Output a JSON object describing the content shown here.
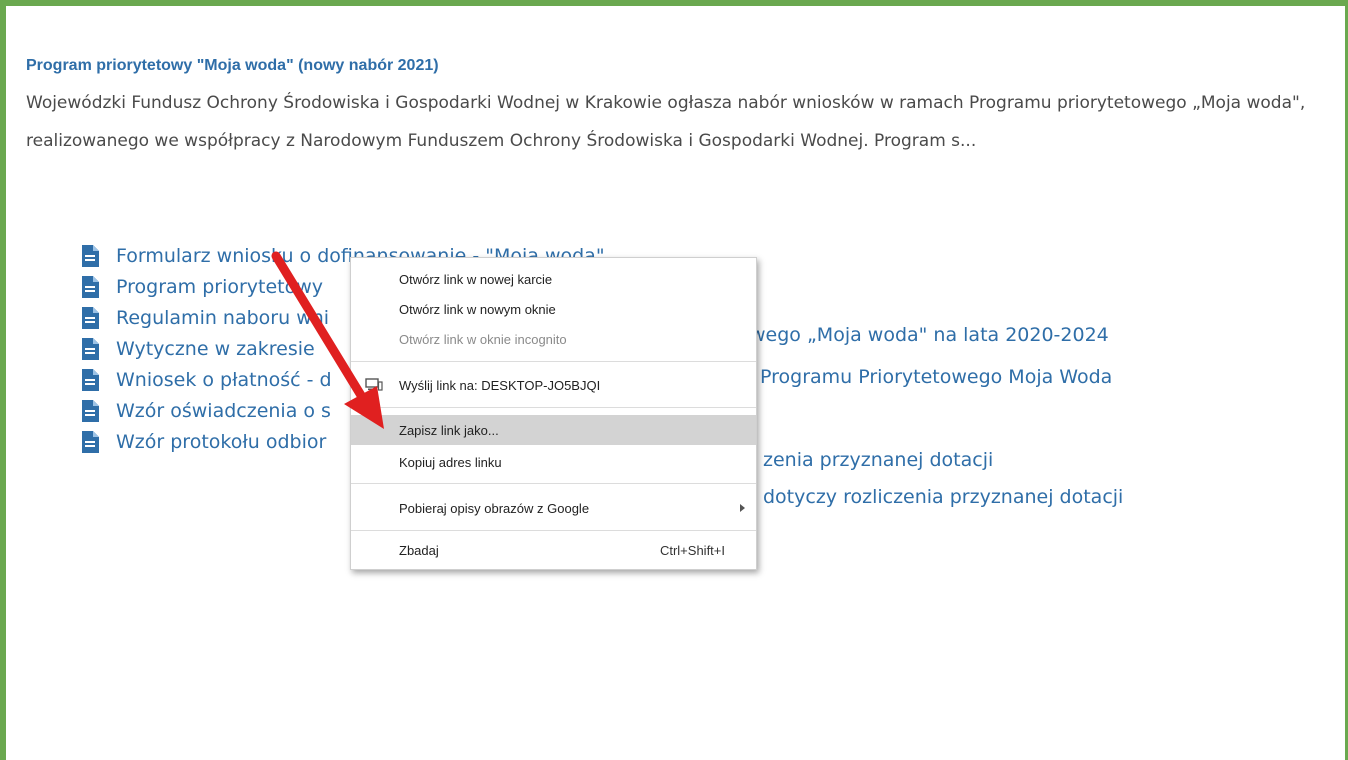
{
  "article": {
    "title": "Program priorytetowy \"Moja woda\" (nowy nabór 2021)",
    "description": "Wojewódzki Fundusz Ochrony Środowiska i Gospodarki Wodnej w Krakowie ogłasza nabór wniosków w ramach Programu priorytetowego „Moja woda\", realizowanego we współpracy z Narodowym Funduszem Ochrony Środowiska i Gospodarki Wodnej. Program s..."
  },
  "attachments": [
    {
      "left": "Formularz wniosku o dofinansowanie - \"Moja woda\"",
      "right": ""
    },
    {
      "left": "Program priorytetowy",
      "right": ""
    },
    {
      "left": "Regulamin naboru wni",
      "right": "wego „Moja woda\" na lata 2020-2024"
    },
    {
      "left": "Wytyczne w zakresie",
      "right": "Programu Priorytetowego Moja Woda"
    },
    {
      "left": "Wniosek o płatność - d",
      "right": ""
    },
    {
      "left": "Wzór oświadczenia o s",
      "right": "zenia przyznanej dotacji"
    },
    {
      "left": "Wzór protokołu odbior",
      "right": "dotyczy rozliczenia przyznanej dotacji"
    }
  ],
  "context_menu": {
    "items": [
      {
        "label": "Otwórz link w nowej karcie"
      },
      {
        "label": "Otwórz link w nowym oknie"
      },
      {
        "label": "Otwórz link w oknie incognito"
      },
      {
        "label": "Wyślij link na: DESKTOP-JO5BJQI"
      },
      {
        "label": "Zapisz link jako..."
      },
      {
        "label": "Kopiuj adres linku"
      },
      {
        "label": "Pobieraj opisy obrazów z Google"
      },
      {
        "label": "Zbadaj",
        "shortcut": "Ctrl+Shift+I"
      }
    ]
  },
  "icons": {
    "attachment": "document-icon",
    "send": "send-to-device-icon",
    "submenu": "chevron-right-icon",
    "annotation": "red-arrow"
  },
  "colors": {
    "border": "#6aa84f",
    "link": "#2f6ea8",
    "text": "#4a4a4a",
    "highlight": "#d3d3d3",
    "annotation_arrow": "#e02020"
  }
}
